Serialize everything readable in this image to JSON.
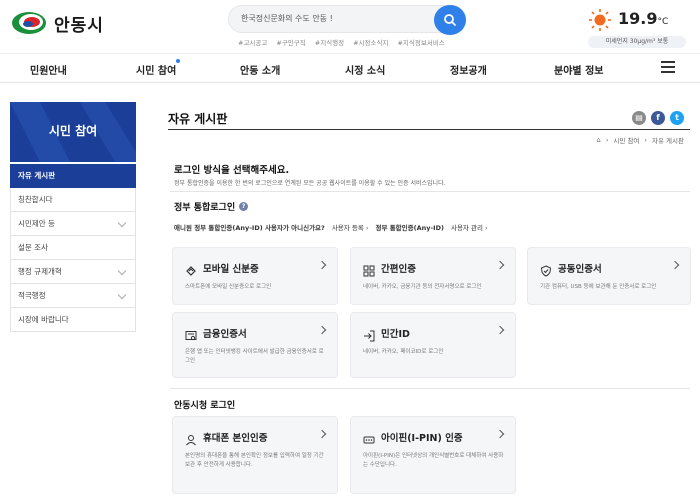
{
  "header": {
    "logo_text": "안동시",
    "search_placeholder": "한국정신문화의 수도 안동 !",
    "tags": [
      "#고시공고",
      "#구인구직",
      "#지식행정",
      "#시정소식지",
      "#지식정보서비스"
    ],
    "weather": {
      "temp": "19.9",
      "unit": "°C",
      "dust": "미세먼지 30μg/m³ 보통"
    }
  },
  "gnb": [
    "민원안내",
    "시민 참여",
    "안동 소개",
    "시정 소식",
    "정보공개",
    "분야별 정보"
  ],
  "sidebar": {
    "title": "시민 참여",
    "items": [
      {
        "label": "자유 게시판",
        "active": true,
        "sub": false
      },
      {
        "label": "칭찬합시다",
        "active": false,
        "sub": false
      },
      {
        "label": "시민제안 등",
        "active": false,
        "sub": true
      },
      {
        "label": "설문 조사",
        "active": false,
        "sub": false
      },
      {
        "label": "행정 규제개혁",
        "active": false,
        "sub": true
      },
      {
        "label": "적극행정",
        "active": false,
        "sub": true
      },
      {
        "label": "시장에 바랍니다",
        "active": false,
        "sub": false
      }
    ]
  },
  "main": {
    "title": "자유 게시판",
    "breadcrumb": [
      "시민 참여",
      "자유 게시판"
    ],
    "login_heading": "로그인 방식을 선택해주세요.",
    "login_desc": "정부 통합인증을 이용한 한 번의 로그인으로 연계된 모든 공공 웹사이트를 이용할 수 있는 인증 서비스입니다.",
    "gov_heading": "정부 통합로그인",
    "gov_links": {
      "q1": "애니원 정부 통합인증(Any-ID) 사용자가 아니신가요?",
      "l1": "사용자 등록",
      "q2": "정부 통합인증(Any-ID)",
      "l2": "사용자 관리"
    },
    "cards": [
      {
        "title": "모바일 신분증",
        "desc": "스마트폰에 모바일 신분증으로 로그인",
        "icon": "id-card-icon"
      },
      {
        "title": "간편인증",
        "desc": "네이버, 카카오, 금융기관 등의 전자서명으로 로그인",
        "icon": "grid-icon"
      },
      {
        "title": "공동인증서",
        "desc": "기관 컴퓨터, USB 등에 보관해 둔 인증서로 로그인",
        "icon": "shield-icon"
      },
      {
        "title": "금융인증서",
        "desc": "은행 앱 또는 인터넷뱅킹 사이트에서 발급한 금융인증서로 로그인",
        "icon": "certificate-icon"
      },
      {
        "title": "민간ID",
        "desc": "네이버, 카카오, 페이코ID로 로그인",
        "icon": "login-icon"
      }
    ],
    "city_heading": "안동시청 로그인",
    "city_cards": [
      {
        "title": "휴대폰 본인인증",
        "desc": "본인명의 휴대폰을 통해 본인확인 정보를 입력하여 일정 기간 보관 후 안전하게 사용합니다.",
        "icon": "person-icon"
      },
      {
        "title": "아이핀(I-PIN) 인증",
        "desc": "아이핀(I-PIN)은 인터넷상의 개인식별번호로 대체하여 사용하는 수단입니다.",
        "icon": "ipin-icon"
      }
    ]
  },
  "colors": {
    "primary": "#1b3f98",
    "accent": "#2f80e8"
  }
}
